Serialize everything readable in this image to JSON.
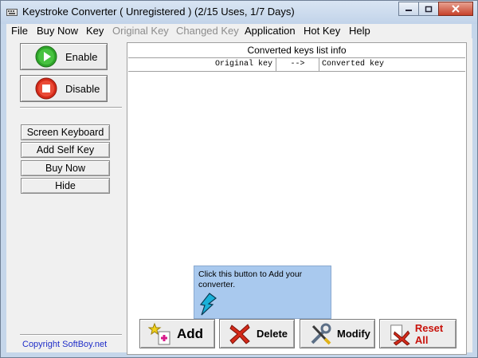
{
  "window": {
    "title": "Keystroke Converter  ( Unregistered ) (2/15 Uses, 1/7 Days)",
    "icon": "keyboard-app-icon"
  },
  "menu": {
    "file": "File",
    "buy_now": "Buy Now",
    "key": "Key",
    "original_key": "Original Key",
    "changed_key": "Changed Key",
    "application": "Application",
    "hot_key": "Hot Key",
    "help": "Help"
  },
  "left": {
    "enable": "Enable",
    "disable": "Disable",
    "screen_keyboard": "Screen Keyboard",
    "add_self_key": "Add Self Key",
    "buy_now": "Buy Now",
    "hide": "Hide",
    "copyright": "Copyright  SoftBoy.net"
  },
  "list": {
    "title": "Converted  keys list info",
    "col_original": "Original key",
    "col_arrow": "-->",
    "col_converted": "Converted key"
  },
  "tooltip": {
    "text": "Click this button to Add your converter."
  },
  "actions": {
    "add": "Add",
    "delete": "Delete",
    "modify": "Modify",
    "reset_all": "Reset All"
  },
  "colors": {
    "accent_green": "#2fa52a",
    "stop_red": "#d42a1a",
    "reset_red": "#c8120b",
    "link_blue": "#1f2dc8",
    "tooltip_bg": "#a9c9ee"
  }
}
